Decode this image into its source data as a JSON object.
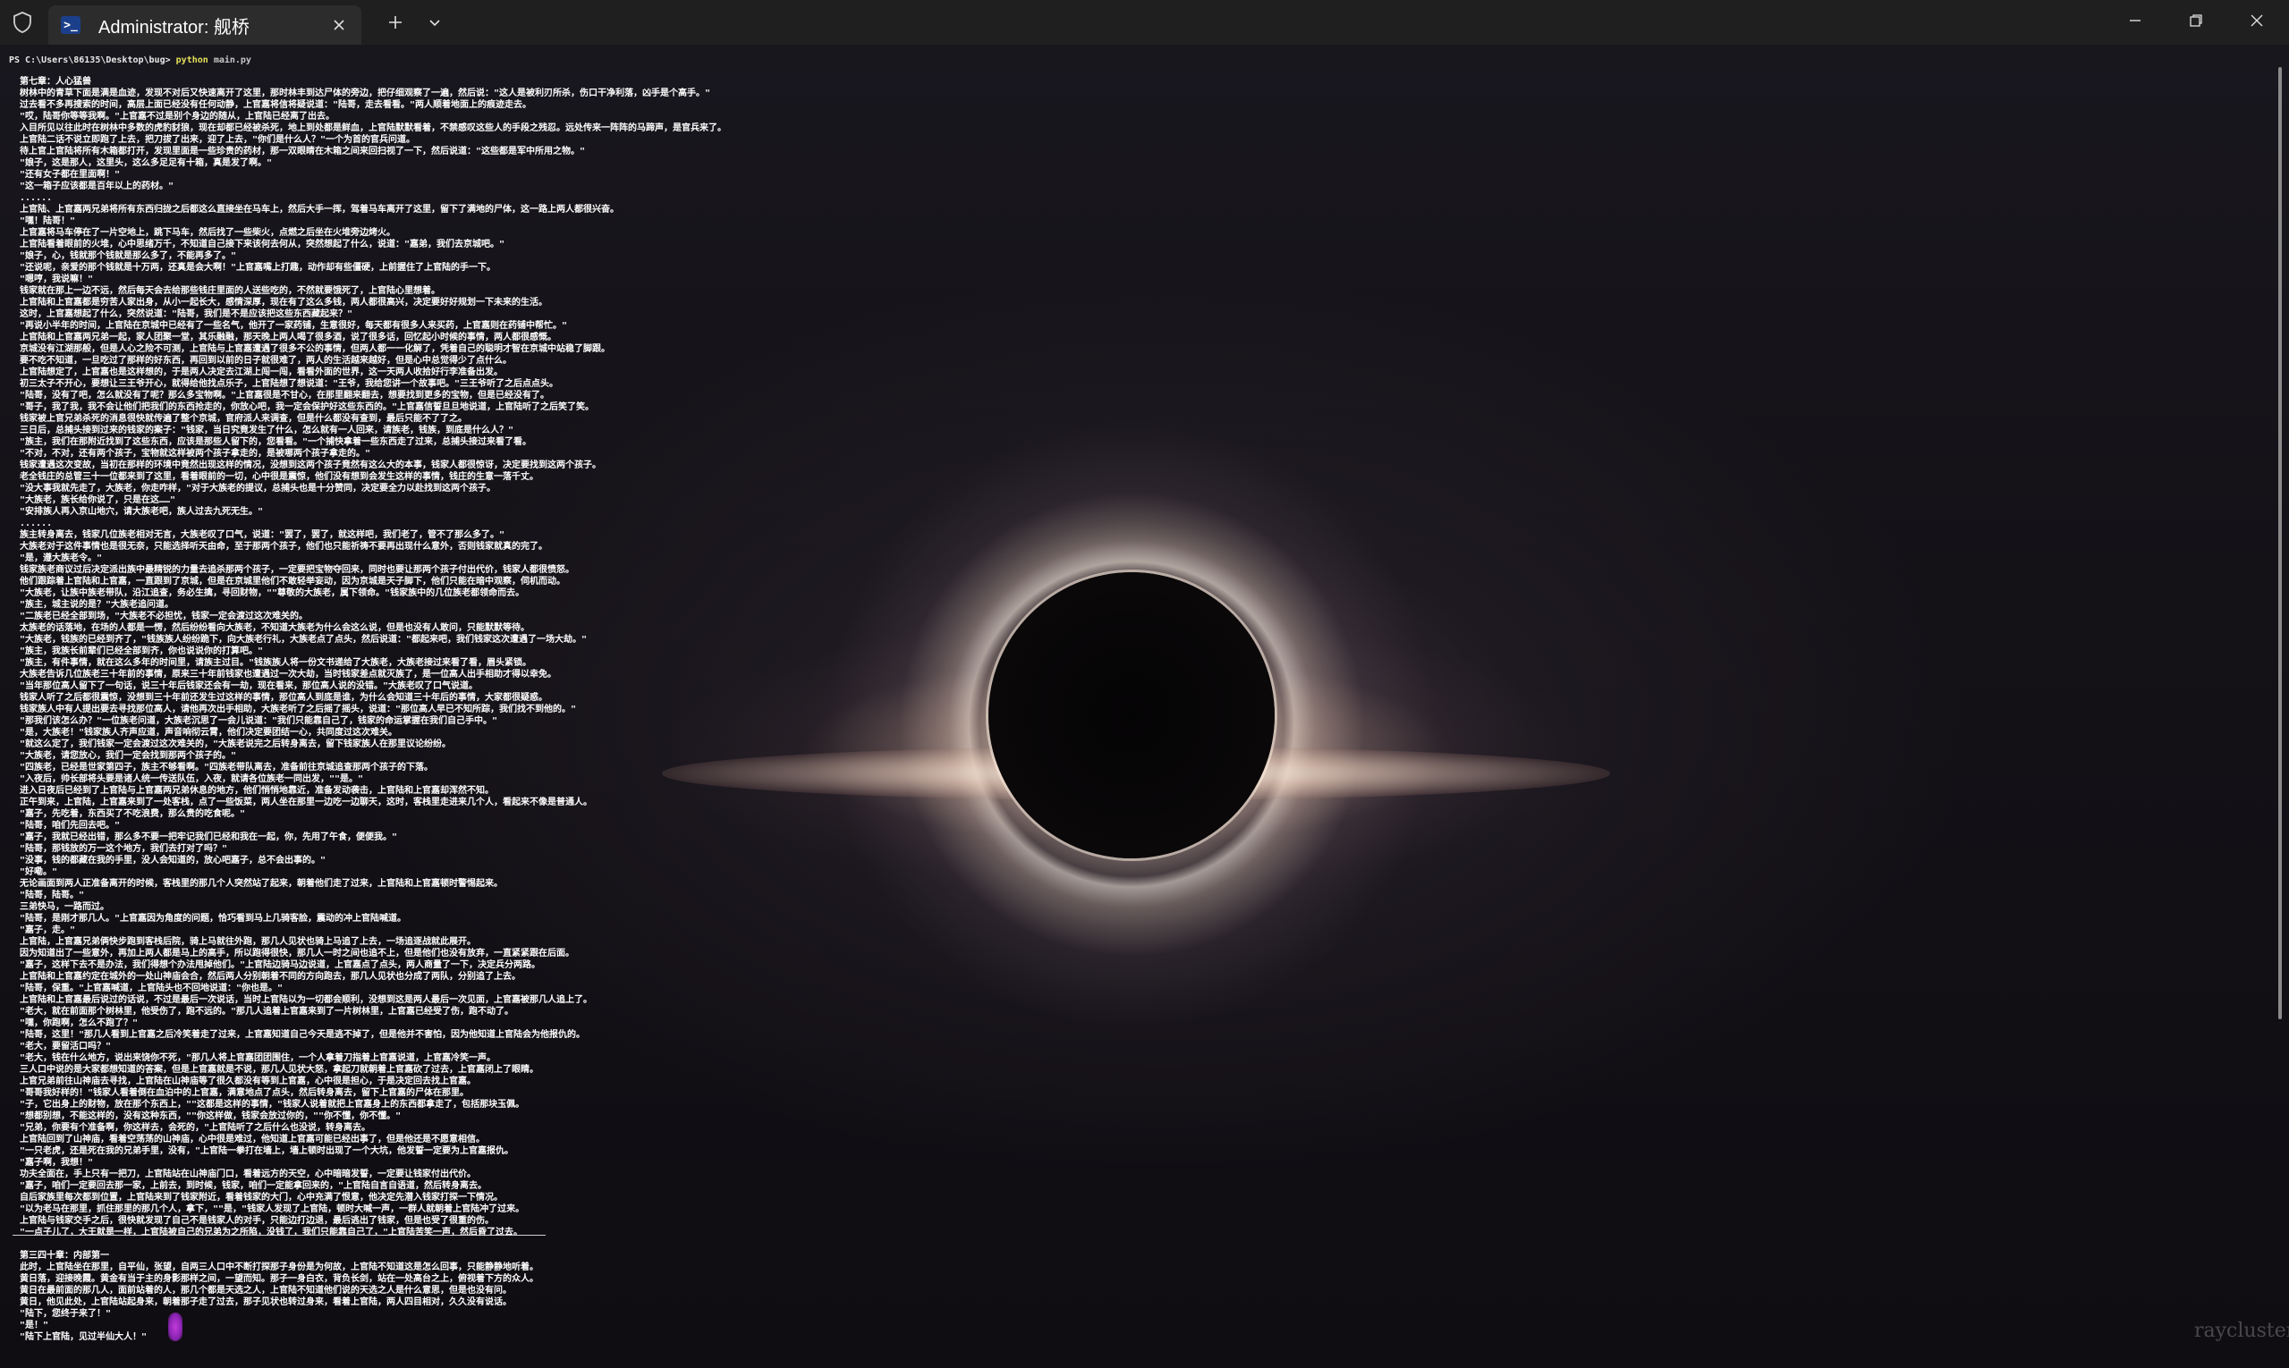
{
  "titlebar": {
    "tab_title": "Administrator: 舰桥",
    "tab_icon_text": ">_"
  },
  "terminal": {
    "prompt": "PS C:\\Users\\86135\\Desktop\\bug>",
    "command": "python",
    "argument": "main.py",
    "chapter1_lines": [
      "  第七章：人心猛兽",
      "树林中的青草下面是满是血迹，发现不对后又快速离开了这里，那时林丰到达尸体的旁边，把仔细观察了一遍，然后说：\"这人是被利刃所杀，伤口干净利落，凶手是个高手。\"",
      "过去看不多再搜索的时间，高层上面已经没有任何动静，上官嘉将信将疑说道：\"陆哥，走去看看。\"两人顺着地面上的痕迹走去。",
      "\"哎，陆哥你等等我啊。\"上官嘉不过是别个身边的随从，上官陆已经离了出去。",
      "入目所见以往此时在树林中多数的虎豹豺狼，现在却都已经被杀死，地上到处都是鲜血，上官陆默默看着，不禁感叹这些人的手段之残忍。远处传来一阵阵的马蹄声，是官兵来了。",
      "上官陆二话不说立即跑了上去，把刀拔了出来，迎了上去，\"你们是什么人？\"一个为首的官兵问道。",
      "待上官上官陆将所有木箱都打开，发现里面是一些珍贵的药材，那一双眼睛在木箱之间来回扫视了一下，然后说道：\"这些都是军中所用之物。\"",
      "\"娘子，这是那人，这里头，这么多足足有十箱，真是发了啊。\"",
      "\"还有女子都在里面啊！\"",
      "\"这一箱子应该都是百年以上的药材。\"",
      "......",
      "上官陆、上官嘉两兄弟将所有东西归拢之后都这么直接坐在马车上，然后大手一挥，驾着马车离开了这里，留下了满地的尸体，这一路上两人都很兴奋。",
      "\"嘿！陆哥！\"",
      "上官嘉将马车停在了一片空地上，跳下马车，然后找了一些柴火，点燃之后坐在火堆旁边烤火。",
      "上官陆看着眼前的火堆，心中思绪万千，不知道自己接下来该何去何从，突然想起了什么，说道：\"嘉弟，我们去京城吧。\"",
      "\"娘子，心，钱就那个钱就是那么多了，不能再多了。\"",
      "\"还说呢，亲爱的那个钱就是十万两，还真是会大啊！\"上官嘉嘴上打趣，动作却有些僵硬，上前握住了上官陆的手一下。",
      "\"嗯哼，我说嘛！\"",
      "钱家就在那上一边不远，然后每天会去给那些钱庄里面的人送些吃的，不然就要饿死了，上官陆心里想着。",
      "上官陆和上官嘉都是穷苦人家出身，从小一起长大，感情深厚，现在有了这么多钱，两人都很高兴，决定要好好规划一下未来的生活。",
      "这时，上官嘉想起了什么，突然说道：\"陆哥，我们是不是应该把这些东西藏起来？\"",
      "\"再说小半年的时间，上官陆在京城中已经有了一些名气，他开了一家药铺，生意很好，每天都有很多人来买药，上官嘉则在药铺中帮忙。\"",
      "上官陆和上官嘉两兄弟一起，家人团聚一堂，其乐融融，那天晚上两人喝了很多酒，说了很多话，回忆起小时候的事情，两人都很感慨。",
      "京城没有江湖那般，但是人心之险不可测，上官陆与上官嘉遭遇了很多不公的事情，但两人都一一化解了，凭着自己的聪明才智在京城中站稳了脚跟。",
      "要不吃不知道，一旦吃过了那样的好东西，再回到以前的日子就很难了，两人的生活越来越好，但是心中总觉得少了点什么。",
      "上官陆想定了，上官嘉也是这样想的，于是两人决定去江湖上闯一闯，看看外面的世界，这一天两人收拾好行李准备出发。",
      "初三太子不开心，要想让三王爷开心，就得给他找点乐子，上官陆想了想说道：\"王爷，我给您讲一个故事吧。\"三王爷听了之后点点头。",
      "\"陆哥，没有了吧，怎么就没有了呢？那么多宝物啊。\"上官嘉很是不甘心，在那里翻来翻去，想要找到更多的宝物，但是已经没有了。",
      "\"哥子，我了我，我不会让他们把我们的东西抢走的，你放心吧，我一定会保护好这些东西的。\"上官嘉信誓旦旦地说道，上官陆听了之后笑了笑。",
      "钱家被上官兄弟杀死的消息很快就传遍了整个京城，官府派人来调查，但是什么都没有查到，最后只能不了了之。",
      "三日后，总捕头接到过来的钱家的案子：\"钱家，当日究竟发生了什么，怎么就有一人回来，请族老，钱族，到底是什么人？\"",
      "\"族主，我们在那附近找到了这些东西，应该是那些人留下的，您看看。\"一个捕快拿着一些东西走了过来，总捕头接过来看了看。",
      "\"不对，不对，还有两个孩子，宝物就这样被两个孩子拿走的，是被哪两个孩子拿走的。\"",
      "钱家遭遇这次变故，当初在那样的环境中竟然出现这样的情况，没想到这两个孩子竟然有这么大的本事，钱家人都很惊讶，决定要找到这两个孩子。",
      "老全钱庄的总管三十一位都来到了这里，看着眼前的一切，心中很是震惊，他们没有想到会发生这样的事情，钱庄的生意一落千丈。",
      "\"没大事我就先走了，大族老，你走咋样，\"对于大族老的提议，总捕头也是十分赞同，决定要全力以赴找到这两个孩子。",
      "\"大族老，族长给你说了，只是在这……\"",
      "\"安排族人再入京山地穴，请大族老吧，族人过去九死无生。\"",
      "......",
      "族主转身离去，钱家几位族老相对无言，大族老叹了口气，说道：\"罢了，罢了，就这样吧，我们老了，管不了那么多了。\"",
      "大族老对于这件事情也是很无奈，只能选择听天由命，至于那两个孩子，他们也只能祈祷不要再出现什么意外，否则钱家就真的完了。",
      "\"是，遵大族老令。\"",
      "钱家族老商议过后决定派出族中最精锐的力量去追杀那两个孩子，一定要把宝物夺回来，同时也要让那两个孩子付出代价，钱家人都很愤怒。",
      "他们跟踪着上官陆和上官嘉，一直跟到了京城，但是在京城里他们不敢轻举妄动，因为京城是天子脚下，他们只能在暗中观察，伺机而动。",
      "\"大族老，让族中族老带队，沿江追查，务必生擒，寻回财物，\"\"尊敬的大族老，属下领命。\"钱家族中的几位族老都领命而去。",
      "\"族主，城主说的是？\"大族老追问道。",
      "\"二族老已经全部到场，\"大族老不必担忧，钱家一定会渡过这次难关的。",
      "太族老的话落地，在场的人都是一愣，然后纷纷看向大族老，不知道大族老为什么会这么说，但是也没有人敢问，只能默默等待。",
      "\"大族老，钱族的已经到齐了，\"钱族族人纷纷跪下，向大族老行礼，大族老点了点头，然后说道：\"都起来吧，我们钱家这次遭遇了一场大劫。\"",
      "\"族主，我族长前辈们已经全部到齐，你也说说你的打算吧。\"",
      "\"族主，有件事情，就在这么多年的时间里，请族主过目。\"钱族族人将一份文书递给了大族老，大族老接过来看了看，眉头紧锁。",
      "大族老告诉几位族老三十年前的事情，原来三十年前钱家也遭遇过一次大劫，当时钱家差点就灭族了，是一位高人出手相助才得以幸免。",
      "\"当年那位高人留下了一句话，说三十年后钱家还会有一劫，现在看来，那位高人说的没错。\"大族老叹了口气说道。",
      "钱家人听了之后都很震惊，没想到三十年前还发生过这样的事情，那位高人到底是谁，为什么会知道三十年后的事情，大家都很疑惑。",
      "钱家族人中有人提出要去寻找那位高人，请他再次出手相助，大族老听了之后摇了摇头，说道：\"那位高人早已不知所踪，我们找不到他的。\"",
      "\"那我们该怎么办？\"一位族老问道，大族老沉思了一会儿说道：\"我们只能靠自己了，钱家的命运掌握在我们自己手中。\"",
      "\"是，大族老！\"钱家族人齐声应道，声音响彻云霄，他们决定要团结一心，共同度过这次难关。",
      "\"就这么定了，我们钱家一定会渡过这次难关的，\"大族老说完之后转身离去，留下钱家族人在那里议论纷纷。",
      "\"大族老，请您放心，我们一定会找到那两个孩子的。\"",
      "\"四族老，已经是世家第四子，族主不够看啊。\"四族老带队离去，准备前往京城追查那两个孩子的下落。",
      "\"入夜后，帅长部将头要是诸人统一传送队伍，入夜，就请各位族老一同出发，\"\"是。\"",
      "进入日夜后已经到了上官陆与上官嘉两兄弟休息的地方，他们悄悄地靠近，准备发动袭击，上官陆和上官嘉却浑然不知。",
      "正午到来，上官陆，上官嘉来到了一处客栈，点了一些饭菜，两人坐在那里一边吃一边聊天，这时，客栈里走进来几个人，看起来不像是普通人。",
      "\"嘉子，先吃着，东西买了不吃浪费，那么贵的吃食呢。\"",
      "\"陆哥，咱们先回去吧。\"",
      "\"嘉子，我就已经出错，那么多不要一把牢记我们已经和我在一起，你，先用了午食，便便我。\"",
      "\"陆哥，那钱放的万一这个地方，我们去打对了吗？\"",
      "\"没事，钱的都藏在我的手里，没人会知道的，放心吧嘉子，总不会出事的。\"",
      "\"好嘞。\"",
      "无论画面到两人正准备离开的时候，客栈里的那几个人突然站了起来，朝着他们走了过来，上官陆和上官嘉顿时警惕起来。",
      "\"陆哥，陆哥。\"",
      "三弟快马，一路而过。",
      "\"陆哥，是刚才那几人。\"上官嘉因为角度的问题，恰巧看到马上几骑客脸，震动的冲上官陆喊道。",
      "\"嘉子，走。\"",
      "上官陆，上官嘉兄弟俩快步跑到客栈后院，骑上马就往外跑，那几人见状也骑上马追了上去，一场追逐战就此展开。",
      "因为知道出了一些意外，再加上两人都是马上的高手，所以跑得很快，那几人一时之间也追不上，但是他们也没有放弃，一直紧紧跟在后面。",
      "\"嘉子，这样下去不是办法，我们得想个办法甩掉他们。\"上官陆边骑马边说道，上官嘉点了点头，两人商量了一下，决定兵分两路。",
      "上官陆和上官嘉约定在城外的一处山神庙会合，然后两人分别朝着不同的方向跑去，那几人见状也分成了两队，分别追了上去。",
      "\"陆哥，保重。\"上官嘉喊道，上官陆头也不回地说道：\"你也是。\"",
      "上官陆和上官嘉最后说过的话说，不过是最后一次说话，当时上官陆以为一切都会顺利，没想到这是两人最后一次见面，上官嘉被那几人追上了。",
      "\"老大，就在前面那个树林里，他受伤了，跑不远的。\"那几人追着上官嘉来到了一片树林里，上官嘉已经受了伤，跑不动了。",
      "\"嘿，你跑啊，怎么不跑了？\"",
      "\"陆哥，这里！\"那几人看到上官嘉之后冷笑着走了过来，上官嘉知道自己今天是逃不掉了，但是他并不害怕，因为他知道上官陆会为他报仇的。",
      "\"老大，要留活口吗？\"",
      "\"老大，钱在什么地方，说出来饶你不死，\"那几人将上官嘉团团围住，一个人拿着刀指着上官嘉说道，上官嘉冷笑一声。",
      "三人口中说的是大家都想知道的答案，但是上官嘉就是不说，那几人见状大怒，拿起刀就朝着上官嘉砍了过去，上官嘉闭上了眼睛。",
      "上官兄弟前往山神庙去寻找，上官陆在山神庙等了很久都没有等到上官嘉，心中很是担心，于是决定回去找上官嘉。",
      "\"哥哥我好样的！\"钱家人看着倒在血泊中的上官嘉，满意地点了点头，然后转身离去，留下上官嘉的尸体在那里。",
      "\"子，它出身上的财物，放在那个东西上，\"\"这都是这样的事情，\"钱家人说着就把上官嘉身上的东西都拿走了，包括那块玉佩。",
      "\"想都别想，不能这样的，没有这种东西，\"\"你这样做，钱家会放过你的，\"\"你不懂，你不懂。\"",
      "\"兄弟，你要有个准备啊，你这样去，会死的，\"上官陆听了之后什么也没说，转身离去。",
      "上官陆回到了山神庙，看着空荡荡的山神庙，心中很是难过，他知道上官嘉可能已经出事了，但是他还是不愿意相信。",
      "\"一只老虎，还是死在我的兄弟手里，没有，\"上官陆一拳打在墙上，墙上顿时出现了一个大坑，他发誓一定要为上官嘉报仇。",
      "\"嘉子啊，我想！\"",
      "功夫全面在，手上只有一把刀，上官陆站在山神庙门口，看着远方的天空，心中暗暗发誓，一定要让钱家付出代价。",
      "\"嘉子，咱们一定要回去那一家，上前去，到时候，钱家，咱们一定能拿回来的，\"上官陆自言自语道，然后转身离去。",
      "自后家族里每次都到位置，上官陆来到了钱家附近，看着钱家的大门，心中充满了恨意，他决定先潜入钱家打探一下情况。",
      "\"以为老马在那里，抓住那里的那几个人，拿下，\"\"是，\"钱家人发现了上官陆，顿时大喊一声，一群人就朝着上官陆冲了过来。",
      "上官陆与钱家交手之后，很快就发现了自己不是钱家人的对手，只能边打边退，最后逃出了钱家，但是也受了很重的伤。",
      "\"一点子儿了，大王就是一样，上官陆被自己的兄弟为之所陷，没钱了，我们只能靠自己了，\"上官陆苦笑一声，然后昏了过去。"
    ],
    "chapter2_lines": [
      "  第三四十章：内部第一",
      "此时，上官陆坐在那里，自平仙，张望，自两三人口中不断打探那子身份是为何故，上官陆不知道这是怎么回事，只能静静地听着。",
      "黄日落，迎接晚霞。黄金有当于主的身影那样之间，一望而知。那子一身白衣，背负长剑，站在一处高台之上，俯视着下方的众人。",
      "黄日在最前面的那几人，面前站着的人，那几个都是天选之人，上官陆不知道他们说的天选之人是什么意思，但是也没有问。",
      "黄日，他见此处，上官陆站起身来，朝着那子走了过去，那子见状也转过身来，看着上官陆，两人四目相对，久久没有说话。",
      "\"陆下，您终于来了！\"",
      "\"是！\"",
      "\"陆下上官陆，见过半仙大人！\""
    ]
  },
  "watermark": "raycluster"
}
